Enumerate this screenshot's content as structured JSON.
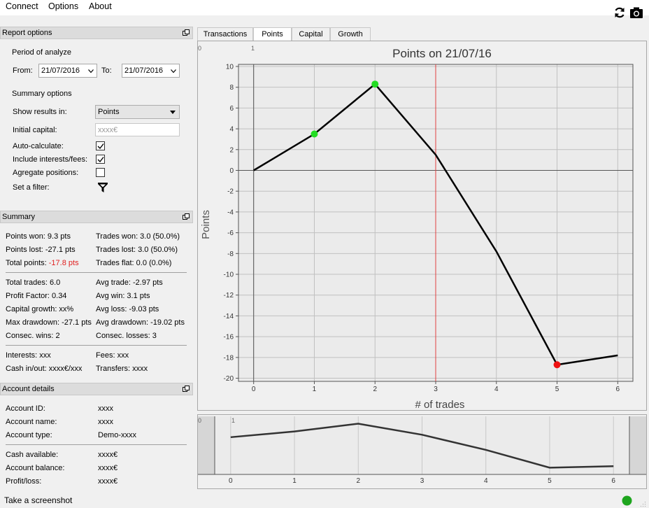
{
  "menu": {
    "connect": "Connect",
    "options": "Options",
    "about": "About"
  },
  "toolbar": {
    "refresh_icon": "refresh-icon",
    "screenshot_icon": "camera-icon"
  },
  "report_options": {
    "header": "Report options",
    "period_label": "Period of analyze",
    "from_label": "From:",
    "from_value": "21/07/2016",
    "to_label": "To:",
    "to_value": "21/07/2016",
    "summary_label": "Summary options",
    "show_results_label": "Show results in:",
    "show_results_value": "Points",
    "initial_capital_label": "Initial capital:",
    "initial_capital_placeholder": "xxxx€",
    "auto_calculate_label": "Auto-calculate:",
    "auto_calculate": true,
    "include_fees_label": "Include interests/fees:",
    "include_fees": true,
    "aggregate_label": "Agregate positions:",
    "aggregate": false,
    "filter_label": "Set a filter:"
  },
  "summary": {
    "header": "Summary",
    "points_won": "Points won: 9.3 pts",
    "points_lost": "Points lost: -27.1 pts",
    "total_points_label": "Total points:",
    "total_points_value": "-17.8 pts",
    "trades_won": "Trades won: 3.0 (50.0%)",
    "trades_lost": "Trades lost: 3.0 (50.0%)",
    "trades_flat": "Trades flat: 0.0 (0.0%)",
    "total_trades": "Total trades: 6.0",
    "profit_factor": "Profit Factor: 0.34",
    "capital_growth": "Capital growth: xx%",
    "max_drawdown": "Max drawdown: -27.1 pts",
    "consec_wins": "Consec. wins: 2",
    "avg_trade": "Avg trade: -2.97 pts",
    "avg_win": "Avg win: 3.1 pts",
    "avg_loss": "Avg loss: -9.03 pts",
    "avg_drawdown": "Avg drawdown: -19.02 pts",
    "consec_losses": "Consec. losses: 3",
    "interests": "Interests: xxx",
    "fees": "Fees: xxx",
    "cash_inout": "Cash in/out: xxxx€/xxx",
    "transfers": "Transfers: xxxx"
  },
  "account": {
    "header": "Account details",
    "rows": [
      {
        "label": "Account ID:",
        "value": "xxxx"
      },
      {
        "label": "Account name:",
        "value": "xxxx"
      },
      {
        "label": "Account type:",
        "value": "Demo-xxxx"
      }
    ],
    "rows2": [
      {
        "label": "Cash available:",
        "value": "xxxx€"
      },
      {
        "label": "Account balance:",
        "value": "xxxx€"
      },
      {
        "label": "Profit/loss:",
        "value": "xxxx€"
      }
    ]
  },
  "tabs": [
    "Transactions",
    "Points",
    "Capital",
    "Growth"
  ],
  "active_tab": "Points",
  "chart_data": [
    {
      "type": "line",
      "title": "Points on 21/07/16",
      "xlabel": "# of trades",
      "ylabel": "Points",
      "x": [
        0,
        1,
        2,
        3,
        4,
        5,
        6
      ],
      "y": [
        0,
        3.5,
        8.3,
        1.5,
        -7.8,
        -18.7,
        -17.8
      ],
      "xlim": [
        -0.25,
        6.25
      ],
      "ylim": [
        -20.3,
        10.2
      ],
      "xticks": [
        "0",
        "1",
        "2",
        "3",
        "4",
        "5",
        "6"
      ],
      "yticks": [
        "10",
        "8",
        "6",
        "4",
        "2",
        "0",
        "-2",
        "-4",
        "-6",
        "-8",
        "-10",
        "-12",
        "-14",
        "-16",
        "-18",
        "-20"
      ],
      "marker_points": [
        {
          "x": 1,
          "y": 3.5,
          "color": "#22dd22"
        },
        {
          "x": 2,
          "y": 8.3,
          "color": "#22dd22"
        },
        {
          "x": 5,
          "y": 18.7,
          "color": "#ee1111",
          "note": "min"
        }
      ],
      "vertical_marker_x": 3,
      "corner_labels": [
        "0",
        "1"
      ],
      "grid": true,
      "line_color": "#000000",
      "marker_line_color": "#e04040"
    },
    {
      "type": "line",
      "role": "overview",
      "x": [
        0,
        1,
        2,
        3,
        4,
        5,
        6
      ],
      "y": [
        0,
        3.5,
        8.3,
        1.5,
        -7.8,
        -18.7,
        -17.8
      ],
      "xticks": [
        "0",
        "1",
        "2",
        "3",
        "4",
        "5",
        "6"
      ],
      "corner_labels": [
        "0",
        "1"
      ],
      "grid": true,
      "line_color": "#333333"
    }
  ],
  "status": {
    "screenshot_label": "Take a screenshot",
    "connection_color": "#1ea51e"
  }
}
